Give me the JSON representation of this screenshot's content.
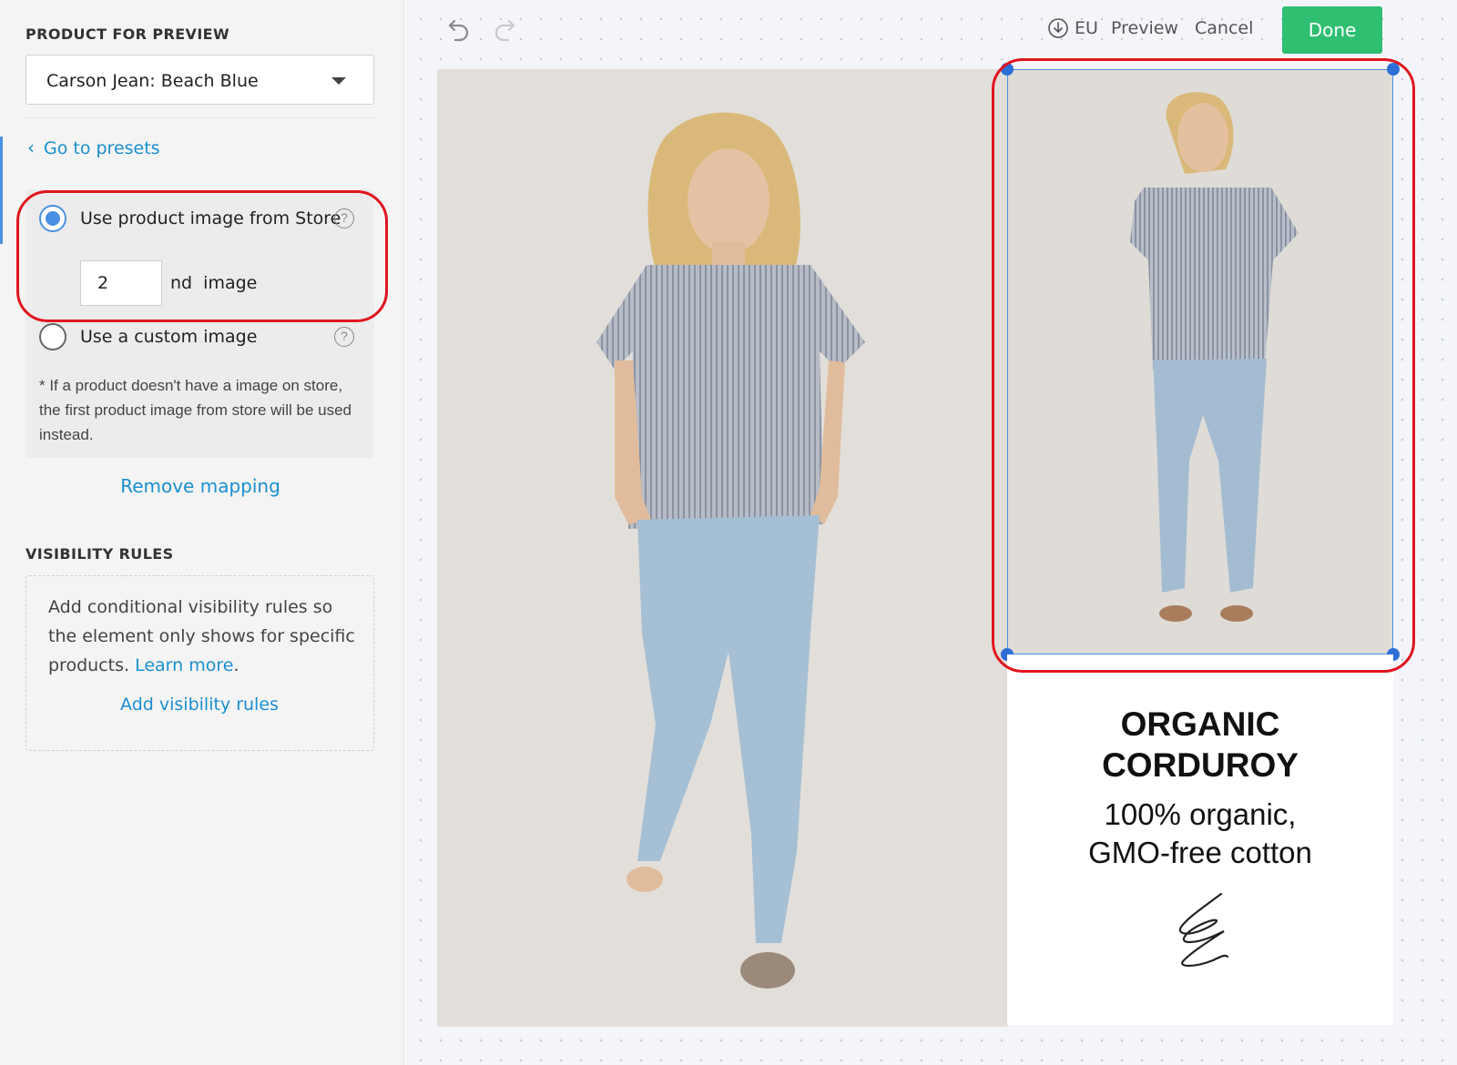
{
  "sidebar": {
    "product_section_title": "PRODUCT FOR PREVIEW",
    "product_select": {
      "value": "Carson Jean: Beach Blue"
    },
    "back_link": "Go to presets",
    "options": {
      "store_image_label": "Use product image from Store",
      "image_index_value": "2",
      "image_index_suffix": "nd  image",
      "custom_image_label": "Use a custom image",
      "selected": "store"
    },
    "note": "* If a product doesn't have a image on store, the first product image from store will be used instead.",
    "remove_mapping": "Remove mapping",
    "visibility": {
      "title": "VISIBILITY RULES",
      "text": "Add conditional visibility rules so the element only shows for specific products.",
      "learn_more": "Learn more",
      "learn_suffix": ".",
      "add_button": "Add visibility rules"
    }
  },
  "toolbar": {
    "icons": [
      "undo-icon",
      "redo-icon",
      "download-icon"
    ],
    "region": "EU",
    "preview": "Preview",
    "cancel": "Cancel",
    "done": "Done",
    "done_color": "#2fbf71"
  },
  "canvas": {
    "text_panel": {
      "title_line1": "ORGANIC",
      "title_line2": "CORDUROY",
      "sub_line1": "100% organic,",
      "sub_line2": "GMO-free cotton"
    }
  },
  "colors": {
    "accent": "#4a90e2",
    "link": "#1a8fcf",
    "highlight": "#e0151f"
  }
}
